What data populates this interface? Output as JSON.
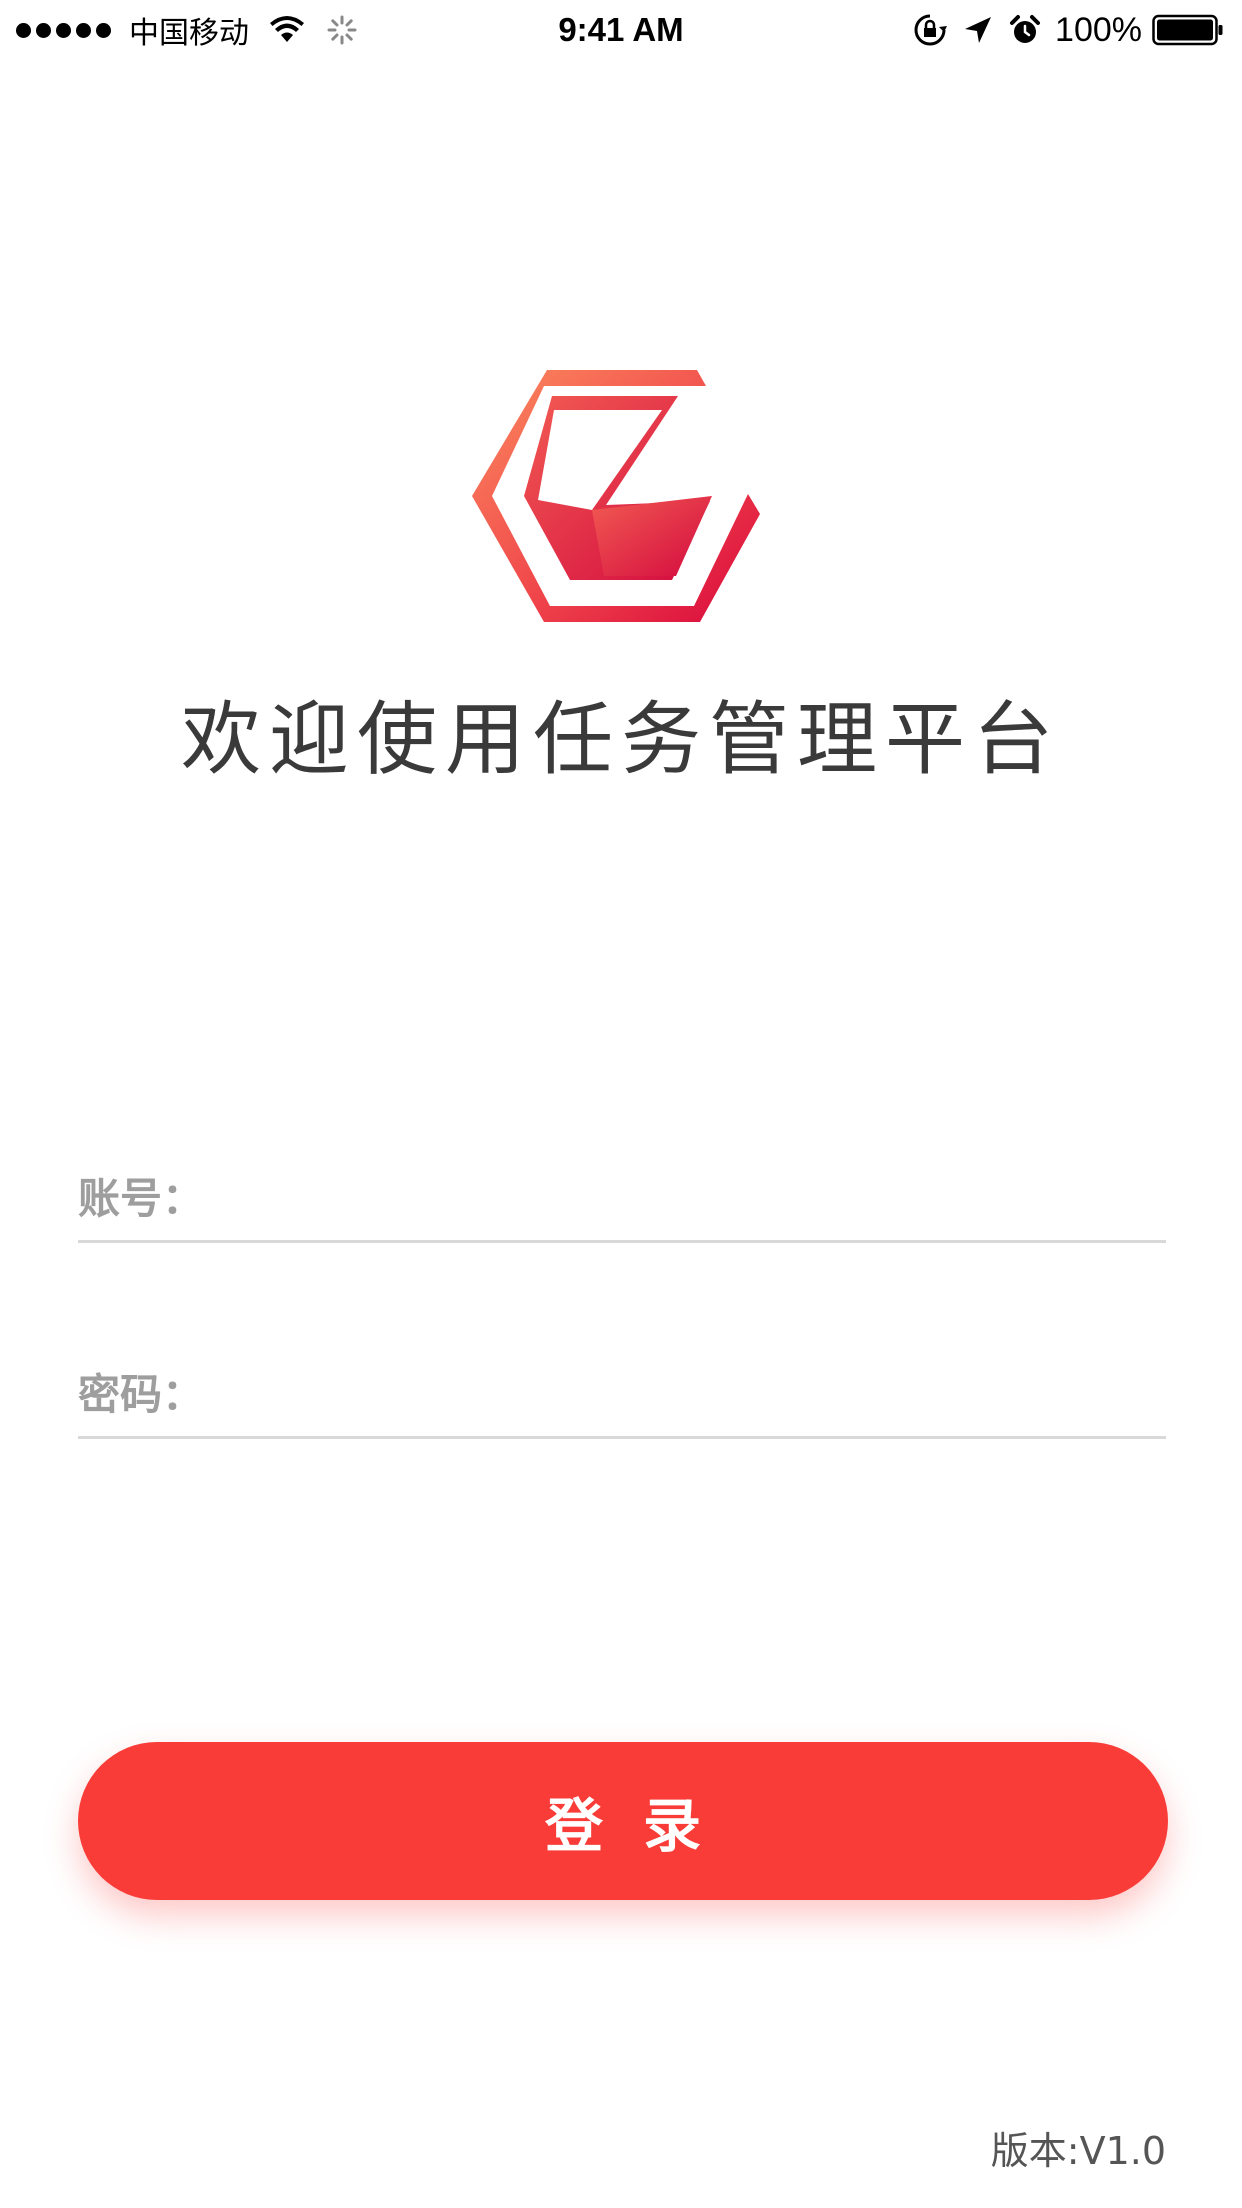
{
  "status_bar": {
    "carrier": "中国移动",
    "time": "9:41 AM",
    "battery": "100%",
    "icons": [
      "signal-dots",
      "wifi-icon",
      "activity-icon",
      "rotation-lock-icon",
      "location-arrow-icon",
      "alarm-clock-icon",
      "battery-icon"
    ]
  },
  "brand": {
    "logo_icon": "hexagon-check-logo",
    "welcome_title": "欢迎使用任务管理平台",
    "accent_color": "#f93c38"
  },
  "form": {
    "account_label": "账号：",
    "account_value": "",
    "password_label": "密码：",
    "password_value": ""
  },
  "login_button_label": "登录",
  "version_text": "版本:V1.0"
}
